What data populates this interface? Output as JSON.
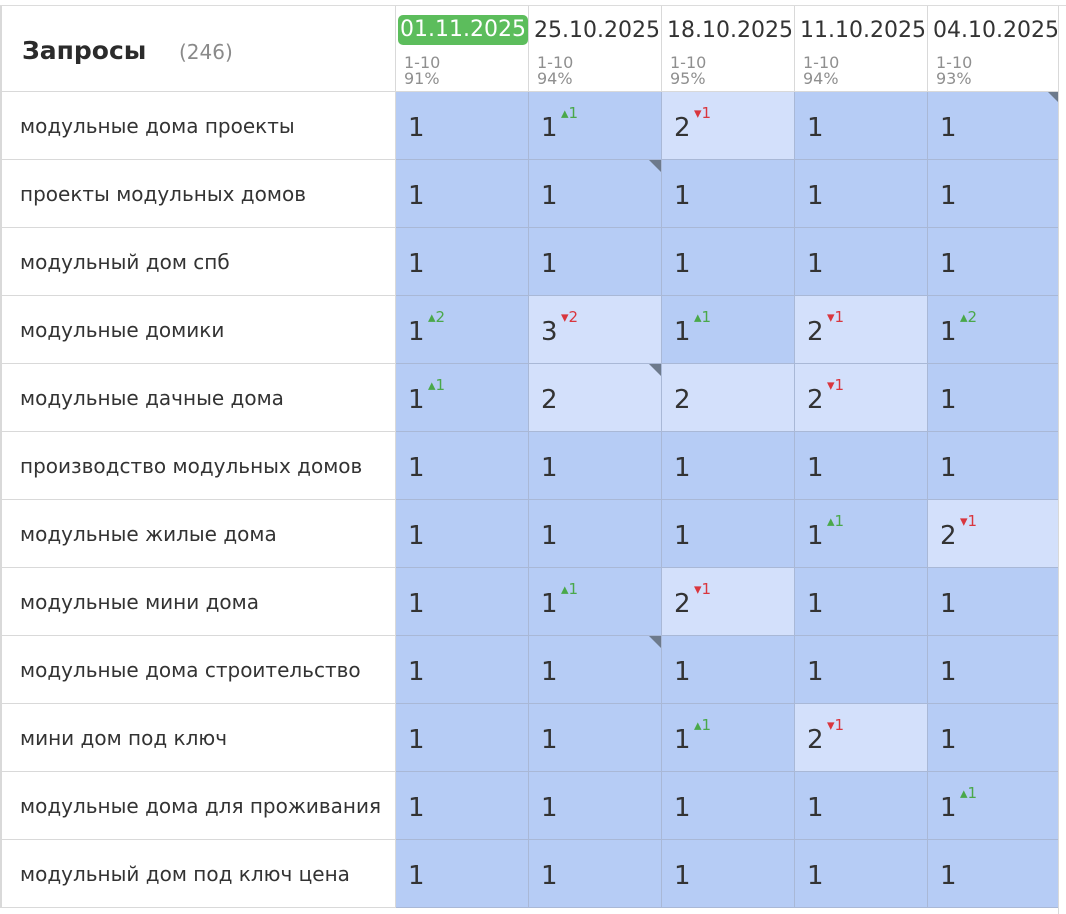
{
  "header": {
    "title": "Запросы",
    "count": "(246)"
  },
  "dates": [
    {
      "date": "01.11.2025",
      "range": "1-10",
      "pct": "91%",
      "active": true
    },
    {
      "date": "25.10.2025",
      "range": "1-10",
      "pct": "94%",
      "active": false
    },
    {
      "date": "18.10.2025",
      "range": "1-10",
      "pct": "95%",
      "active": false
    },
    {
      "date": "11.10.2025",
      "range": "1-10",
      "pct": "94%",
      "active": false
    },
    {
      "date": "04.10.2025",
      "range": "1-10",
      "pct": "93%",
      "active": false
    }
  ],
  "colors": {
    "active_date": "#5cbd5c",
    "cell_top": "#b6ccf5",
    "cell_light": "#d3e0fb",
    "up": "#4aa84a",
    "down": "#d9363e",
    "marker": "#6d7a8c"
  },
  "rows": [
    {
      "query": "модульные дома проекты",
      "cells": [
        {
          "v": "1",
          "d": "",
          "dir": "",
          "c": ""
        },
        {
          "v": "1",
          "d": "▴1",
          "dir": "up",
          "c": ""
        },
        {
          "v": "2",
          "d": "▾1",
          "dir": "down",
          "c": ""
        },
        {
          "v": "1",
          "d": "",
          "dir": "",
          "c": ""
        },
        {
          "v": "1",
          "d": "",
          "dir": "",
          "c": "marker"
        }
      ]
    },
    {
      "query": "проекты модульных домов",
      "cells": [
        {
          "v": "1",
          "d": "",
          "dir": "",
          "c": ""
        },
        {
          "v": "1",
          "d": "",
          "dir": "",
          "c": "marker"
        },
        {
          "v": "1",
          "d": "",
          "dir": "",
          "c": ""
        },
        {
          "v": "1",
          "d": "",
          "dir": "",
          "c": ""
        },
        {
          "v": "1",
          "d": "",
          "dir": "",
          "c": ""
        }
      ]
    },
    {
      "query": "модульный дом спб",
      "cells": [
        {
          "v": "1",
          "d": "",
          "dir": "",
          "c": ""
        },
        {
          "v": "1",
          "d": "",
          "dir": "",
          "c": ""
        },
        {
          "v": "1",
          "d": "",
          "dir": "",
          "c": ""
        },
        {
          "v": "1",
          "d": "",
          "dir": "",
          "c": ""
        },
        {
          "v": "1",
          "d": "",
          "dir": "",
          "c": ""
        }
      ]
    },
    {
      "query": "модульные домики",
      "cells": [
        {
          "v": "1",
          "d": "▴2",
          "dir": "up",
          "c": ""
        },
        {
          "v": "3",
          "d": "▾2",
          "dir": "down",
          "c": ""
        },
        {
          "v": "1",
          "d": "▴1",
          "dir": "up",
          "c": ""
        },
        {
          "v": "2",
          "d": "▾1",
          "dir": "down",
          "c": ""
        },
        {
          "v": "1",
          "d": "▴2",
          "dir": "up",
          "c": ""
        }
      ]
    },
    {
      "query": "модульные дачные дома",
      "cells": [
        {
          "v": "1",
          "d": "▴1",
          "dir": "up",
          "c": ""
        },
        {
          "v": "2",
          "d": "",
          "dir": "",
          "c": "marker"
        },
        {
          "v": "2",
          "d": "",
          "dir": "",
          "c": ""
        },
        {
          "v": "2",
          "d": "▾1",
          "dir": "down",
          "c": ""
        },
        {
          "v": "1",
          "d": "",
          "dir": "",
          "c": ""
        }
      ]
    },
    {
      "query": "производство модульных домов",
      "cells": [
        {
          "v": "1",
          "d": "",
          "dir": "",
          "c": ""
        },
        {
          "v": "1",
          "d": "",
          "dir": "",
          "c": ""
        },
        {
          "v": "1",
          "d": "",
          "dir": "",
          "c": ""
        },
        {
          "v": "1",
          "d": "",
          "dir": "",
          "c": ""
        },
        {
          "v": "1",
          "d": "",
          "dir": "",
          "c": ""
        }
      ]
    },
    {
      "query": "модульные жилые дома",
      "cells": [
        {
          "v": "1",
          "d": "",
          "dir": "",
          "c": ""
        },
        {
          "v": "1",
          "d": "",
          "dir": "",
          "c": ""
        },
        {
          "v": "1",
          "d": "",
          "dir": "",
          "c": ""
        },
        {
          "v": "1",
          "d": "▴1",
          "dir": "up",
          "c": ""
        },
        {
          "v": "2",
          "d": "▾1",
          "dir": "down",
          "c": ""
        }
      ]
    },
    {
      "query": "модульные мини дома",
      "cells": [
        {
          "v": "1",
          "d": "",
          "dir": "",
          "c": ""
        },
        {
          "v": "1",
          "d": "▴1",
          "dir": "up",
          "c": ""
        },
        {
          "v": "2",
          "d": "▾1",
          "dir": "down",
          "c": ""
        },
        {
          "v": "1",
          "d": "",
          "dir": "",
          "c": ""
        },
        {
          "v": "1",
          "d": "",
          "dir": "",
          "c": ""
        }
      ]
    },
    {
      "query": "модульные дома строительство",
      "cells": [
        {
          "v": "1",
          "d": "",
          "dir": "",
          "c": ""
        },
        {
          "v": "1",
          "d": "",
          "dir": "",
          "c": "marker"
        },
        {
          "v": "1",
          "d": "",
          "dir": "",
          "c": ""
        },
        {
          "v": "1",
          "d": "",
          "dir": "",
          "c": ""
        },
        {
          "v": "1",
          "d": "",
          "dir": "",
          "c": ""
        }
      ]
    },
    {
      "query": "мини дом под ключ",
      "cells": [
        {
          "v": "1",
          "d": "",
          "dir": "",
          "c": ""
        },
        {
          "v": "1",
          "d": "",
          "dir": "",
          "c": ""
        },
        {
          "v": "1",
          "d": "▴1",
          "dir": "up",
          "c": ""
        },
        {
          "v": "2",
          "d": "▾1",
          "dir": "down",
          "c": ""
        },
        {
          "v": "1",
          "d": "",
          "dir": "",
          "c": ""
        }
      ]
    },
    {
      "query": "модульные дома для проживания",
      "cells": [
        {
          "v": "1",
          "d": "",
          "dir": "",
          "c": ""
        },
        {
          "v": "1",
          "d": "",
          "dir": "",
          "c": ""
        },
        {
          "v": "1",
          "d": "",
          "dir": "",
          "c": ""
        },
        {
          "v": "1",
          "d": "",
          "dir": "",
          "c": ""
        },
        {
          "v": "1",
          "d": "▴1",
          "dir": "up",
          "c": ""
        }
      ]
    },
    {
      "query": "модульный дом под ключ цена",
      "cells": [
        {
          "v": "1",
          "d": "",
          "dir": "",
          "c": ""
        },
        {
          "v": "1",
          "d": "",
          "dir": "",
          "c": ""
        },
        {
          "v": "1",
          "d": "",
          "dir": "",
          "c": ""
        },
        {
          "v": "1",
          "d": "",
          "dir": "",
          "c": ""
        },
        {
          "v": "1",
          "d": "",
          "dir": "",
          "c": ""
        }
      ]
    }
  ]
}
